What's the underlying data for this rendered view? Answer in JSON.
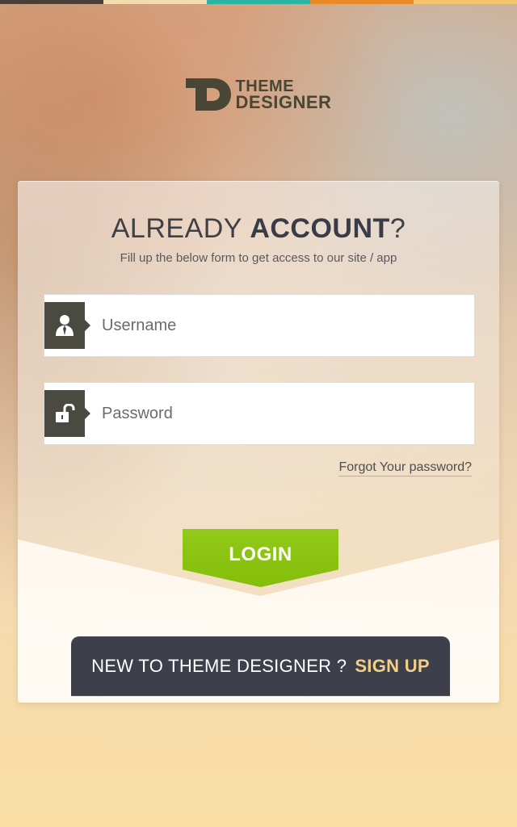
{
  "top_strip_colors": [
    "#4a3f36",
    "#f2dcb0",
    "#2bb3a3",
    "#e98a26",
    "#f3c46a"
  ],
  "brand": {
    "line1": "THEME",
    "line2": "DESIGNER",
    "logo_icon": "td-logo-icon"
  },
  "heading": {
    "prefix": "ALREADY",
    "emphasis": "ACCOUNT",
    "suffix": "?"
  },
  "subheading": "Fill up the below form to get access to our site / app",
  "form": {
    "username": {
      "placeholder": "Username",
      "icon": "user-icon"
    },
    "password": {
      "placeholder": "Password",
      "icon": "unlock-icon"
    },
    "forgot_link": "Forgot Your password?",
    "login_label": "LOGIN"
  },
  "signup": {
    "prompt": "NEW TO THEME DESIGNER ?",
    "link_label": "SIGN UP"
  },
  "colors": {
    "accent_green": "#8ac312",
    "dark_bar": "#3d3f4a",
    "signup_link": "#f2cf86",
    "icon_bg": "#4b4a40"
  }
}
